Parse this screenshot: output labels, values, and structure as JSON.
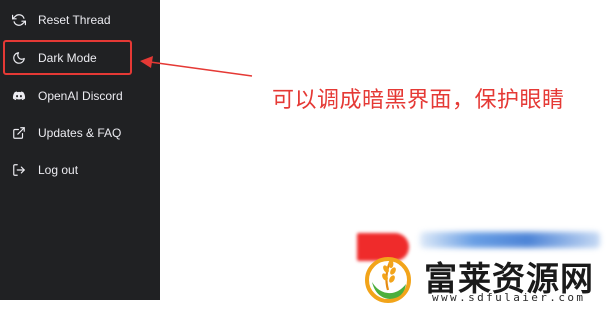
{
  "sidebar": {
    "items": [
      {
        "label": "Reset Thread",
        "icon": "refresh-icon"
      },
      {
        "label": "Dark Mode",
        "icon": "moon-icon"
      },
      {
        "label": "OpenAI Discord",
        "icon": "discord-icon"
      },
      {
        "label": "Updates & FAQ",
        "icon": "external-link-icon"
      },
      {
        "label": "Log out",
        "icon": "logout-icon"
      }
    ],
    "background": "#202123",
    "text_color": "#ececf1"
  },
  "annotation": {
    "text": "可以调成暗黑界面，保护眼睛",
    "color": "#e53935"
  },
  "watermark": {
    "title": "富莱资源网",
    "url": "www.sdfulaier.com"
  }
}
